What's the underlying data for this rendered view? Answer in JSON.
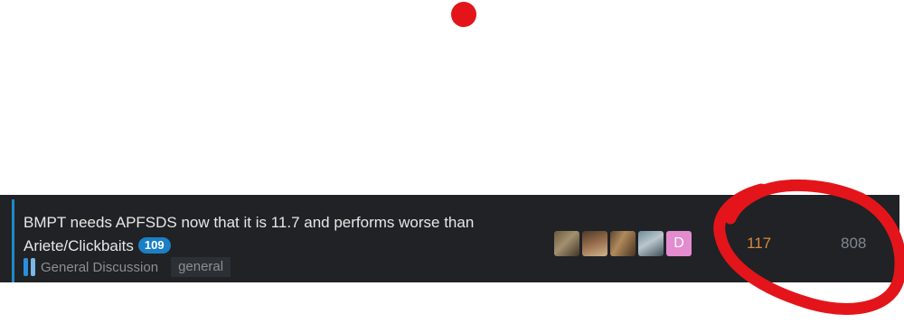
{
  "topic": {
    "title": "BMPT needs APFSDS now that it is 11.7 and performs worse than Ariete/Clickbaits",
    "unread_count": "109",
    "category": "General Discussion",
    "tag": "general",
    "replies": "117",
    "views": "808",
    "posters": [
      {
        "icon": "soldier-avatar-1"
      },
      {
        "icon": "soldier-avatar-2"
      },
      {
        "icon": "soldier-avatar-3"
      },
      {
        "icon": "officer-avatar"
      },
      {
        "letter": "D",
        "color": "#e58bd0"
      }
    ]
  },
  "colors": {
    "row_background": "#202225",
    "accent": "#1e88c8",
    "badge": "#1a7fc4",
    "replies_text": "#d68a3a",
    "annotation": "#e3151a"
  }
}
